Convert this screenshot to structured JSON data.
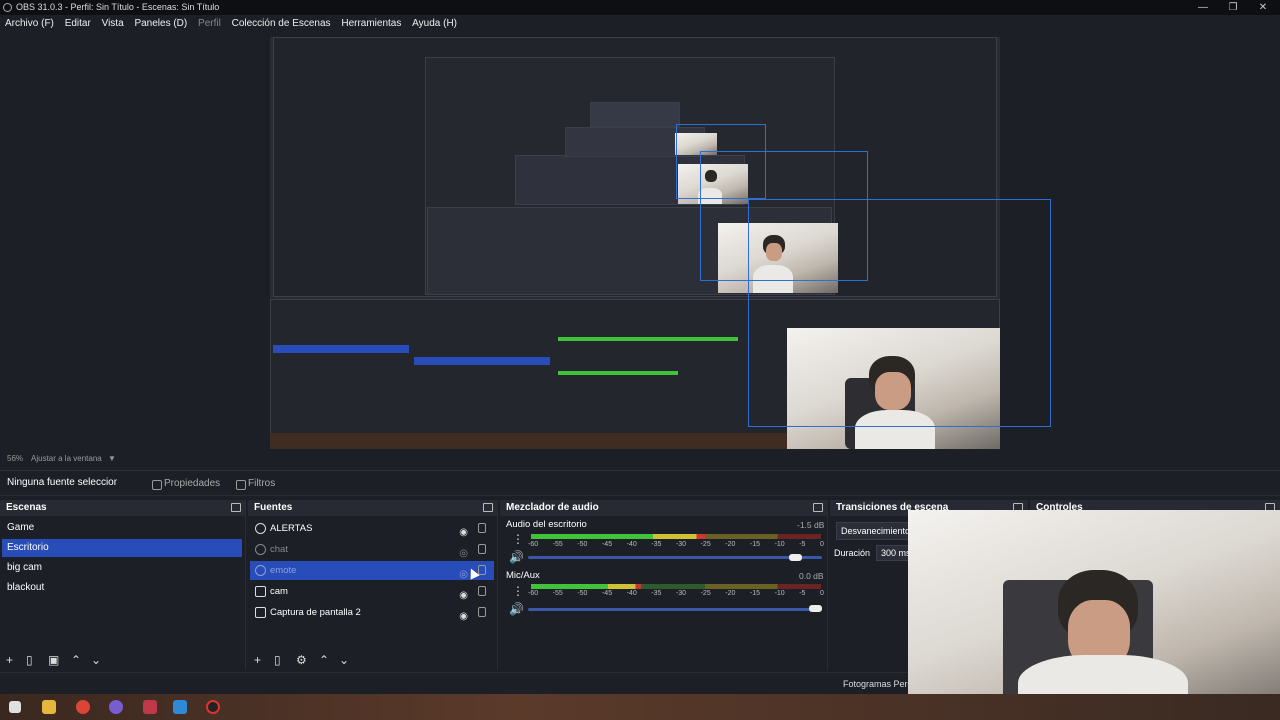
{
  "window": {
    "title": "OBS 31.0.3 - Perfil: Sin Título - Escenas: Sin Título",
    "minimize": "—",
    "maximize": "❐",
    "close": "✕"
  },
  "menu": [
    "Archivo (F)",
    "Editar",
    "Vista",
    "Paneles (D)",
    "Perfil",
    "Colección de Escenas",
    "Herramientas",
    "Ayuda (H)"
  ],
  "preview": {
    "zoom": "56%",
    "fit_label": "Ajustar a la ventana"
  },
  "props": {
    "none_selected": "Ninguna fuente seleccionada",
    "properties": "Propiedades",
    "filters": "Filtros"
  },
  "scenes": {
    "title": "Escenas",
    "items": [
      "Game",
      "Escritorio",
      "big cam",
      "blackout"
    ],
    "selected": 1
  },
  "sources": {
    "title": "Fuentes",
    "items": [
      {
        "name": "ALERTAS",
        "visible": true
      },
      {
        "name": "chat",
        "visible": false
      },
      {
        "name": "emote",
        "visible": false
      },
      {
        "name": "cam",
        "visible": true
      },
      {
        "name": "Captura de pantalla 2",
        "visible": true
      }
    ],
    "selected": 2
  },
  "mixer": {
    "title": "Mezclador de audio",
    "channels": [
      {
        "name": "Audio del escritorio",
        "db": "-1.5 dB",
        "level": 0.6,
        "volume": 0.93
      },
      {
        "name": "Mic/Aux",
        "db": "0.0 dB",
        "level": 0.38,
        "volume": 1.0
      }
    ],
    "scale": [
      "-60",
      "-55",
      "-50",
      "-45",
      "-40",
      "-35",
      "-30",
      "-25",
      "-20",
      "-15",
      "-10",
      "-5",
      "0"
    ]
  },
  "transitions": {
    "title": "Transiciones de escena",
    "type": "Desvanecimiento",
    "duration_label": "Duración",
    "duration": "300 ms"
  },
  "controls": {
    "title": "Controles"
  },
  "status": {
    "frames": "Fotogramas Perdidos"
  },
  "colors": {
    "accent": "#284cb8",
    "bg": "#1d1f26",
    "panel": "#272a33"
  }
}
